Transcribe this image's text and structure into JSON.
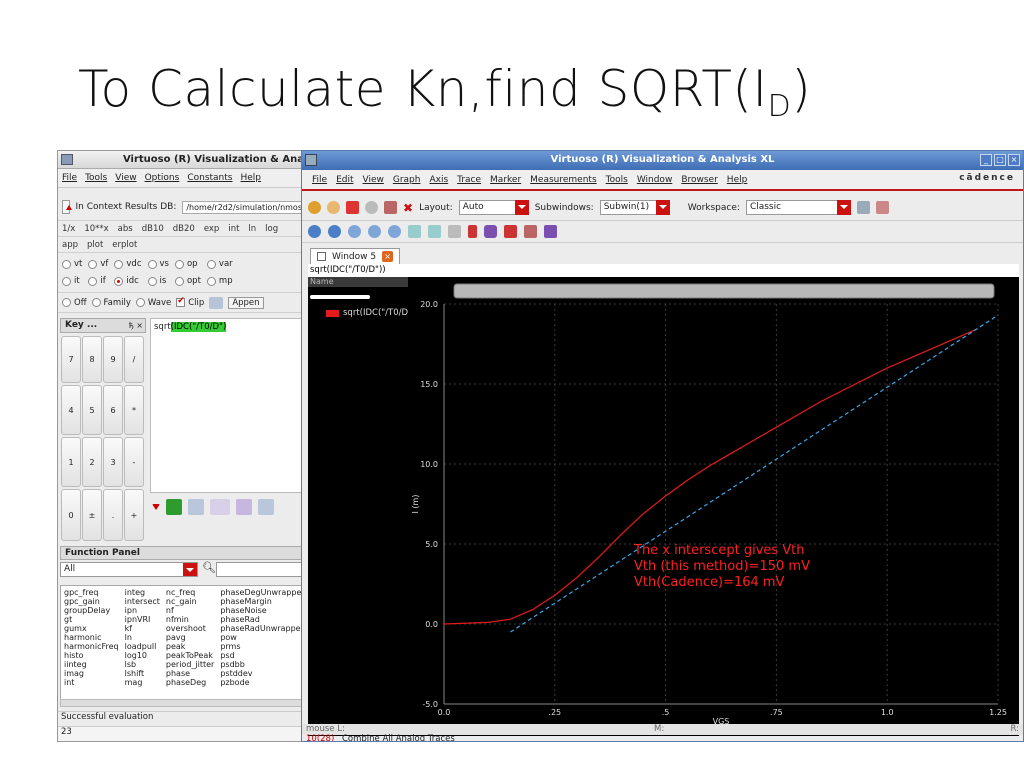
{
  "slide": {
    "title_main": "To Calculate Kn,find SQRT(I",
    "title_sub": "D",
    "title_close": ")"
  },
  "calculator": {
    "window_title": "Virtuoso (R) Visualization & Ana",
    "menu": [
      "File",
      "Tools",
      "View",
      "Options",
      "Constants",
      "Help"
    ],
    "context_label": "In Context Results DB:",
    "context_path": "/home/r2d2/simulation/nmos",
    "func_buttons": [
      "1/x",
      "10**x",
      "abs",
      "dB10",
      "dB20",
      "exp",
      "int",
      "ln",
      "log"
    ],
    "mode_buttons": [
      "app",
      "plot",
      "erplot"
    ],
    "radios_row1": [
      "vt",
      "vf",
      "vdc",
      "vs",
      "op",
      "var"
    ],
    "radios_row2": [
      "it",
      "if",
      "idc",
      "is",
      "opt",
      "mp"
    ],
    "selected_radio": "idc",
    "mode_row": {
      "off": "Off",
      "family": "Family",
      "wave": "Wave",
      "clip": "Clip",
      "append": "Appen"
    },
    "key_panel_title": "Key ...",
    "key_panel_ctrl": "ђ ×",
    "keys": [
      [
        "7",
        "8",
        "9",
        "/"
      ],
      [
        "4",
        "5",
        "6",
        "*"
      ],
      [
        "1",
        "2",
        "3",
        "-"
      ],
      [
        "0",
        "±",
        ".",
        "+"
      ]
    ],
    "expression_prefix": "sqrt",
    "expression_highlight": "(IDC(\"/T0/D\")",
    "function_panel_title": "Function Panel",
    "function_filter": "All",
    "functions": [
      [
        "gpc_freq",
        "gpc_gain",
        "groupDelay",
        "gt",
        "gumx",
        "harmonic",
        "harmonicFreq",
        "histo",
        "iinteg",
        "imag",
        "int"
      ],
      [
        "integ",
        "intersect",
        "ipn",
        "ipnVRI",
        "kf",
        "ln",
        "loadpull",
        "log10",
        "lsb",
        "lshift",
        "mag"
      ],
      [
        "nc_freq",
        "nc_gain",
        "nf",
        "nfmin",
        "overshoot",
        "pavg",
        "peak",
        "peakToPeak",
        "period_jitter",
        "phase",
        "phaseDeg"
      ],
      [
        "phaseDegUnwrapped",
        "phaseMargin",
        "phaseNoise",
        "phaseRad",
        "phaseRadUnwrapped",
        "pow",
        "prms",
        "psd",
        "psdbb",
        "pstddev",
        "pzbode"
      ]
    ],
    "status": "Successful evaluation",
    "status_count": "23"
  },
  "viewer": {
    "window_title": "Virtuoso (R) Visualization & Analysis XL",
    "menu": [
      "File",
      "Edit",
      "View",
      "Graph",
      "Axis",
      "Trace",
      "Marker",
      "Measurements",
      "Tools",
      "Window",
      "Browser",
      "Help"
    ],
    "brand": "cādence",
    "layout_label": "Layout:",
    "layout_value": "Auto",
    "subwindows_label": "Subwindows:",
    "subwindows_value": "Subwin(1)",
    "workspace_label": "Workspace:",
    "workspace_value": "Classic",
    "tab_label": "Window 5",
    "expression_label": "sqrt(IDC(\"/T0/D\"))",
    "name_column": "Name",
    "legend_entry": "sqrt(IDC(\"/T0/D",
    "status_mouse": "mouse L:",
    "status_mid": "M:",
    "status_right": "R:",
    "status_count": "10(28)",
    "status_message": "Combine All Analog Traces"
  },
  "chart_data": {
    "type": "line",
    "xlabel": "VGS",
    "ylabel": "I (m)",
    "xlim": [
      0,
      1.25
    ],
    "ylim": [
      -5,
      20
    ],
    "x_ticks": [
      "0.0",
      ".25",
      ".5",
      ".75",
      "1.0",
      "1.25"
    ],
    "y_ticks": [
      "-5.0",
      "0.0",
      "5.0",
      "10.0",
      "15.0",
      "20.0"
    ],
    "grid": true,
    "background": "#000000",
    "series": [
      {
        "name": "sqrt(IDC(\"/T0/D",
        "color": "#e51b1b",
        "style": "solid",
        "x": [
          0.0,
          0.1,
          0.15,
          0.2,
          0.25,
          0.3,
          0.35,
          0.4,
          0.45,
          0.5,
          0.55,
          0.6,
          0.65,
          0.7,
          0.75,
          0.8,
          0.85,
          0.9,
          0.95,
          1.0,
          1.05,
          1.1,
          1.15,
          1.2
        ],
        "y": [
          0.0,
          0.1,
          0.3,
          0.9,
          1.8,
          2.9,
          4.2,
          5.6,
          6.9,
          8.0,
          9.0,
          9.9,
          10.7,
          11.5,
          12.3,
          13.1,
          13.9,
          14.6,
          15.3,
          16.0,
          16.6,
          17.2,
          17.8,
          18.4
        ]
      },
      {
        "name": "",
        "color": "#3aa6e8",
        "style": "dashed",
        "x": [
          0.15,
          1.25
        ],
        "y": [
          -0.5,
          19.3
        ]
      }
    ],
    "annotations": [
      "The x interscept gives Vth",
      "Vth (this method)=150 mV",
      "Vth(Cadence)=164 mV"
    ],
    "annotation_color": "#ff2020"
  }
}
